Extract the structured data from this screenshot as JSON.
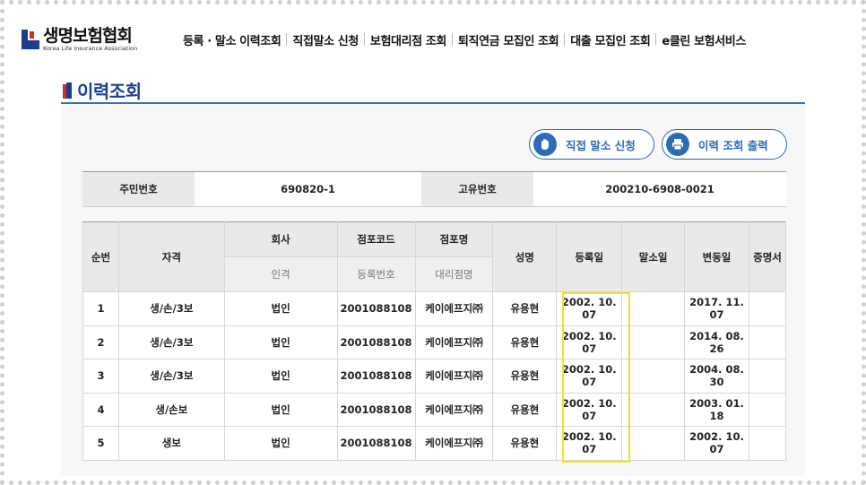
{
  "header": {
    "logo_ko": "생명보험협회",
    "logo_en": "Korea Life Insurance Association",
    "nav": [
      "등록 · 말소 이력조회",
      "직접말소 신청",
      "보험대리점 조회",
      "퇴직연금 모집인 조회",
      "대출 모집인 조회",
      "e클린 보험서비스"
    ]
  },
  "page_title": "이력조회",
  "buttons": {
    "direct_cancel": "직접 말소 신청",
    "print_history": "이력 조회 출력"
  },
  "info": {
    "id_label": "주민번호",
    "id_value": "690820-1",
    "uid_label": "고유번호",
    "uid_value": "200210-6908-0021"
  },
  "table": {
    "headers": {
      "no": "순번",
      "qual": "자격",
      "company": "회사",
      "person": "인격",
      "store_code": "점포코드",
      "reg_no": "등록번호",
      "store_name": "점포명",
      "agency": "대리점명",
      "name": "성명",
      "reg_date": "등록일",
      "cancel_date": "말소일",
      "change_date": "변동일",
      "cert": "증명서"
    },
    "rows": [
      [
        "1",
        "생/손/3보",
        "법인",
        "2001088108",
        "케이에프지㈜",
        "유용현",
        "2002. 10. 07",
        "",
        "2017. 11. 07",
        ""
      ],
      [
        "2",
        "생/손/3보",
        "법인",
        "2001088108",
        "케이에프지㈜",
        "유용현",
        "2002. 10. 07",
        "",
        "2014. 08. 26",
        ""
      ],
      [
        "3",
        "생/손/3보",
        "법인",
        "2001088108",
        "케이에프지㈜",
        "유용현",
        "2002. 10. 07",
        "",
        "2004. 08. 30",
        ""
      ],
      [
        "4",
        "생/손보",
        "법인",
        "2001088108",
        "케이에프지㈜",
        "유용현",
        "2002. 10. 07",
        "",
        "2003. 01. 18",
        ""
      ],
      [
        "5",
        "생보",
        "법인",
        "2001088108",
        "케이에프지㈜",
        "유용현",
        "2002. 10. 07",
        "",
        "2002. 10. 07",
        ""
      ]
    ]
  },
  "colors": {
    "brand_blue": "#1b3f8f",
    "brand_red": "#d62a2a",
    "accent": "#2c6bb8",
    "highlight": "#f4e21a"
  },
  "icons": {
    "cancel": "hand-stop-icon",
    "print": "printer-icon"
  }
}
